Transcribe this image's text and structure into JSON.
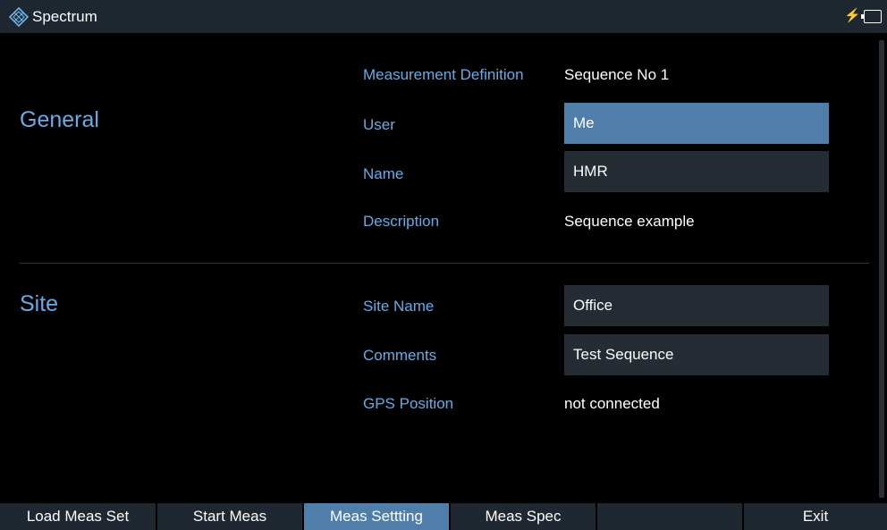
{
  "titlebar": {
    "title": "Spectrum",
    "logo_icon": "rohde-schwarz-logo-icon",
    "status_icons": [
      "charging-bolt-icon",
      "battery-icon"
    ]
  },
  "general": {
    "heading": "General",
    "measurement_definition": {
      "label": "Measurement Definition",
      "value": "Sequence No 1"
    },
    "user": {
      "label": "User",
      "value": "Me"
    },
    "name": {
      "label": "Name",
      "value": "HMR"
    },
    "description": {
      "label": "Description",
      "value": "Sequence example"
    }
  },
  "site": {
    "heading": "Site",
    "site_name": {
      "label": "Site Name",
      "value": "Office"
    },
    "comments": {
      "label": "Comments",
      "value": "Test Sequence"
    },
    "gps_position": {
      "label": "GPS Position",
      "value": "not connected"
    }
  },
  "softkeys": [
    {
      "label": "Load Meas Set"
    },
    {
      "label": "Start Meas"
    },
    {
      "label": "Meas Settting",
      "active": true
    },
    {
      "label": "Meas Spec"
    },
    {
      "label": ""
    },
    {
      "label": "Exit"
    }
  ],
  "colors": {
    "accent_label": "#66ace8",
    "selected_field": "#4f7eaa",
    "field_bg": "#262c33",
    "titlebar_bg": "#1e2630"
  }
}
